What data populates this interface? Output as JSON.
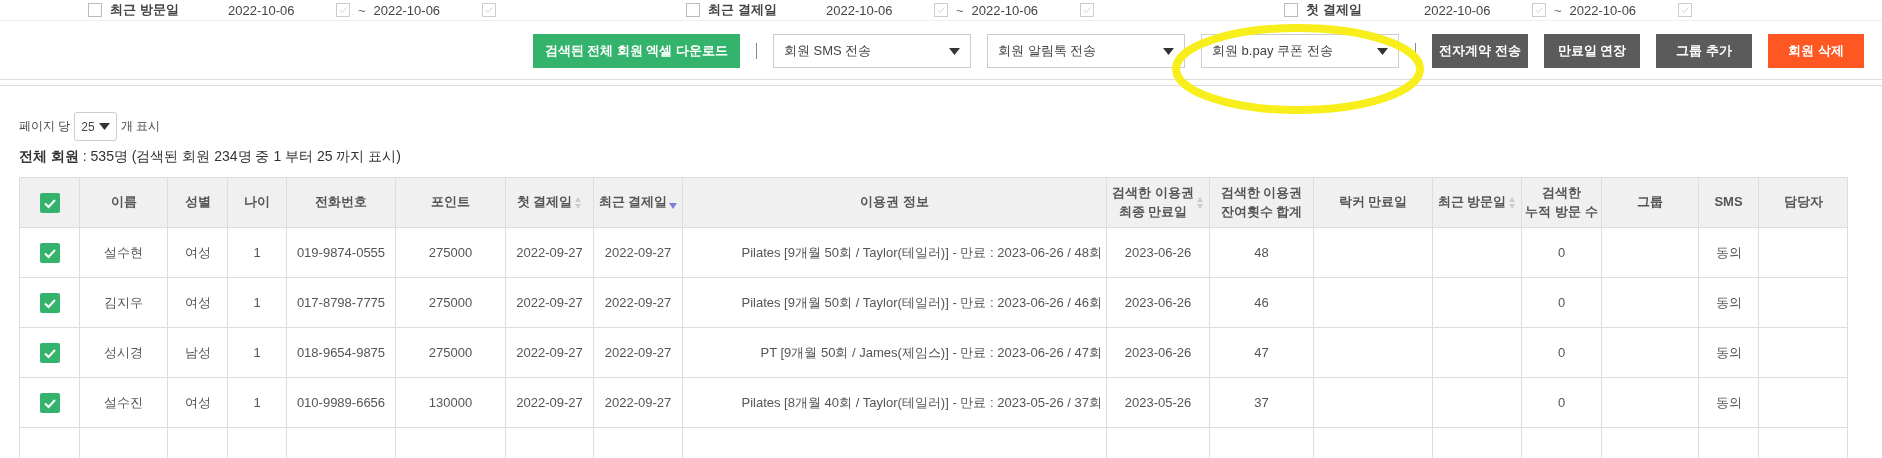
{
  "filters": [
    {
      "label": "최근 방문일",
      "checked": false,
      "from": "2022-10-06",
      "to": "2022-10-06"
    },
    {
      "label": "최근 결제일",
      "checked": false,
      "from": "2022-10-06",
      "to": "2022-10-06"
    },
    {
      "label": "첫 결제일",
      "checked": false,
      "from": "2022-10-06",
      "to": "2022-10-06"
    }
  ],
  "range_separator": "~",
  "actions": {
    "download": "검색된 전체 회원 엑셀 다운로드",
    "selects": [
      {
        "value": "회원 SMS 전송",
        "highlighted": false
      },
      {
        "value": "회원 알림톡 전송",
        "highlighted": false
      },
      {
        "value": "회원 b.pay 쿠폰 전송",
        "highlighted": true
      }
    ],
    "buttons": [
      {
        "label": "전자계약 전송",
        "kind": "dark"
      },
      {
        "label": "만료일 연장",
        "kind": "dark"
      },
      {
        "label": "그룹 추가",
        "kind": "dark"
      },
      {
        "label": "회원 삭제",
        "kind": "danger"
      }
    ]
  },
  "page_size": {
    "prefix": "페이지 당",
    "value": "25",
    "suffix": "개 표시"
  },
  "summary": {
    "label": "전체 회원",
    "text": " : 535명 (검색된 회원 234명 중 1 부터 25 까지 표시)"
  },
  "table": {
    "all_checked": true,
    "columns": [
      {
        "label": "이름",
        "sortable": false
      },
      {
        "label": "성별",
        "sortable": false
      },
      {
        "label": "나이",
        "sortable": false
      },
      {
        "label": "전화번호",
        "sortable": false
      },
      {
        "label": "포인트",
        "sortable": false
      },
      {
        "label": "첫 결제일",
        "sortable": true,
        "sorted": false
      },
      {
        "label": "최근 결제일",
        "sortable": true,
        "sorted": true
      },
      {
        "label": "이용권 정보",
        "sortable": false
      },
      {
        "label": "검색한 이용권\n최종 만료일",
        "sortable": true,
        "sorted": false
      },
      {
        "label": "검색한 이용권\n잔여횟수 합계",
        "sortable": false
      },
      {
        "label": "락커 만료일",
        "sortable": false
      },
      {
        "label": "최근 방문일",
        "sortable": true,
        "sorted": false
      },
      {
        "label": "검색한\n누적 방문 수",
        "sortable": false
      },
      {
        "label": "그룹",
        "sortable": false
      },
      {
        "label": "SMS",
        "sortable": false
      },
      {
        "label": "담당자",
        "sortable": false
      }
    ],
    "rows": [
      {
        "checked": true,
        "cells": [
          "설수현",
          "여성",
          "1",
          "019-9874-0555",
          "275000",
          "2022-09-27",
          "2022-09-27",
          "Pilates [9개월 50회 / Taylor(테일러)] - 만료 : 2023-06-26 / 48회",
          "2023-06-26",
          "48",
          "",
          "",
          "0",
          "",
          "동의",
          ""
        ]
      },
      {
        "checked": true,
        "cells": [
          "김지우",
          "여성",
          "1",
          "017-8798-7775",
          "275000",
          "2022-09-27",
          "2022-09-27",
          "Pilates [9개월 50회 / Taylor(테일러)] - 만료 : 2023-06-26 / 46회",
          "2023-06-26",
          "46",
          "",
          "",
          "0",
          "",
          "동의",
          ""
        ]
      },
      {
        "checked": true,
        "cells": [
          "성시경",
          "남성",
          "1",
          "018-9654-9875",
          "275000",
          "2022-09-27",
          "2022-09-27",
          "PT [9개월 50회 / James(제임스)] - 만료 : 2023-06-26 / 47회",
          "2023-06-26",
          "47",
          "",
          "",
          "0",
          "",
          "동의",
          ""
        ]
      },
      {
        "checked": true,
        "cells": [
          "설수진",
          "여성",
          "1",
          "010-9989-6656",
          "130000",
          "2022-09-27",
          "2022-09-27",
          "Pilates [8개월 40회 / Taylor(테일러)] - 만료 : 2023-05-26 / 37회",
          "2023-05-26",
          "37",
          "",
          "",
          "0",
          "",
          "동의",
          ""
        ]
      }
    ]
  }
}
